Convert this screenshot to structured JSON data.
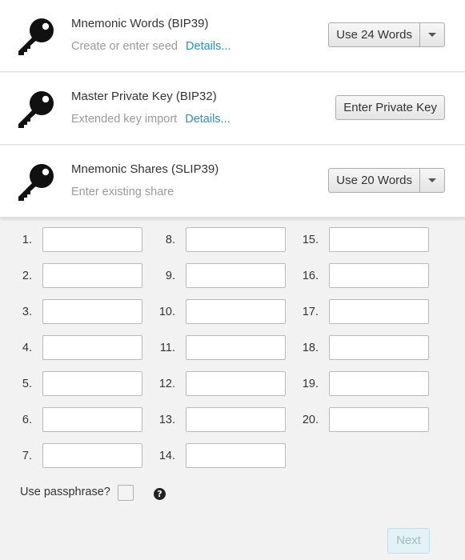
{
  "cards": [
    {
      "title": "Mnemonic Words (BIP39)",
      "subtitle": "Create or enter seed",
      "link": "Details...",
      "button": "Use 24 Words",
      "button_type": "split"
    },
    {
      "title": "Master Private Key (BIP32)",
      "subtitle": "Extended key import",
      "link": "Details...",
      "button": "Enter Private Key",
      "button_type": "plain"
    },
    {
      "title": "Mnemonic Shares (SLIP39)",
      "subtitle": "Enter existing share",
      "link": "",
      "button": "Use 20 Words",
      "button_type": "split"
    }
  ],
  "word_inputs": [
    {
      "label": "1.",
      "value": ""
    },
    {
      "label": "2.",
      "value": ""
    },
    {
      "label": "3.",
      "value": ""
    },
    {
      "label": "4.",
      "value": ""
    },
    {
      "label": "5.",
      "value": ""
    },
    {
      "label": "6.",
      "value": ""
    },
    {
      "label": "7.",
      "value": ""
    },
    {
      "label": "8.",
      "value": ""
    },
    {
      "label": "9.",
      "value": ""
    },
    {
      "label": "10.",
      "value": ""
    },
    {
      "label": "11.",
      "value": ""
    },
    {
      "label": "12.",
      "value": ""
    },
    {
      "label": "13.",
      "value": ""
    },
    {
      "label": "14.",
      "value": ""
    },
    {
      "label": "15.",
      "value": ""
    },
    {
      "label": "16.",
      "value": ""
    },
    {
      "label": "17.",
      "value": ""
    },
    {
      "label": "18.",
      "value": ""
    },
    {
      "label": "19.",
      "value": ""
    },
    {
      "label": "20.",
      "value": ""
    }
  ],
  "passphrase": {
    "label": "Use passphrase?",
    "checked": false,
    "help_icon": "?"
  },
  "next_button": {
    "label": "Next",
    "enabled": false
  },
  "colors": {
    "link": "#2a8fbd",
    "subtitle": "#9a9a9a",
    "next_disabled_bg": "#e4f1f5",
    "next_disabled_text": "#9cbcc8"
  },
  "icons": {
    "card": "key-icon",
    "dropdown": "chevron-down-icon",
    "help": "question-circle-icon"
  }
}
